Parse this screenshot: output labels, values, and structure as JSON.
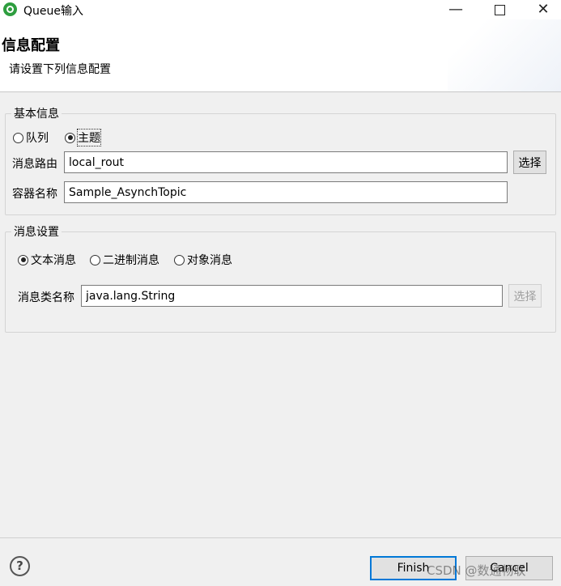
{
  "window": {
    "title": "Queue输入",
    "minimize": "—",
    "close": "✕"
  },
  "header": {
    "title": "信息配置",
    "subtitle": "请设置下列信息配置"
  },
  "basic_info": {
    "legend": "基本信息",
    "radios": [
      {
        "label": "队列",
        "checked": false
      },
      {
        "label": "主题",
        "checked": true
      }
    ],
    "route_label": "消息路由",
    "route_value": "local_rout",
    "select_label": "选择",
    "container_label": "容器名称",
    "container_value": "Sample_AsynchTopic"
  },
  "message_settings": {
    "legend": "消息设置",
    "radios": [
      {
        "label": "文本消息",
        "checked": true
      },
      {
        "label": "二进制消息",
        "checked": false
      },
      {
        "label": "对象消息",
        "checked": false
      }
    ],
    "class_label": "消息类名称",
    "class_value": "java.lang.String",
    "select_label": "选择",
    "select_enabled": false
  },
  "footer": {
    "help": "?",
    "finish_label": "Finish",
    "cancel_label": "Cancel",
    "watermark": "CSDN @数通畅联"
  }
}
